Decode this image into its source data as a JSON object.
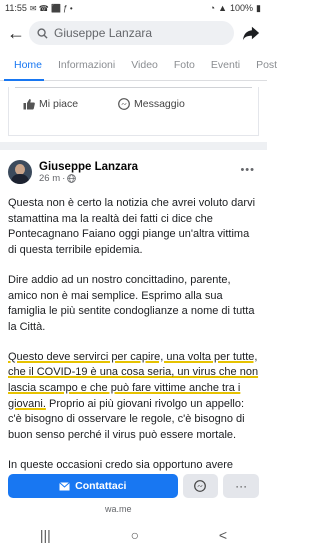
{
  "status": {
    "time": "11:55",
    "battery": "100%"
  },
  "search": {
    "value": "Giuseppe Lanzara"
  },
  "tabs": [
    "Home",
    "Informazioni",
    "Video",
    "Foto",
    "Eventi",
    "Post"
  ],
  "prev_post": {
    "like_label": "Mi piace",
    "message_label": "Messaggio"
  },
  "post": {
    "author": "Giuseppe Lanzara",
    "time": "26 m",
    "p1": "Questa non è certo la notizia che avrei voluto darvi stamattina ma la realtà dei fatti ci dice che Pontecagnano Faiano oggi piange un'altra vittima di questa terribile epidemia.",
    "p2": "Dire addio ad un nostro concittadino, parente, amico non è mai semplice. Esprimo alla sua famiglia le più sentite condoglianze a nome di tutta la Città.",
    "p3_hl": "Questo deve servirci per capire, una volta per tutte, che il COVID-19 è una cosa seria, un virus che non lascia scampo e che può fare vittime anche tra i giovani.",
    "p3_rest": " Proprio ai più giovani rivolgo un appello: c'è bisogno di osservare le regole, c'è bisogno di buon senso perché il virus può essere mortale.",
    "p4": "In queste occasioni credo sia opportuno avere rispetto per la vittima e che si lasci qui, alla"
  },
  "cta": {
    "label": "Contattaci",
    "link": "wa.me",
    "more": "···"
  },
  "colors": {
    "accent": "#1877f2",
    "highlight": "#e6c200"
  }
}
